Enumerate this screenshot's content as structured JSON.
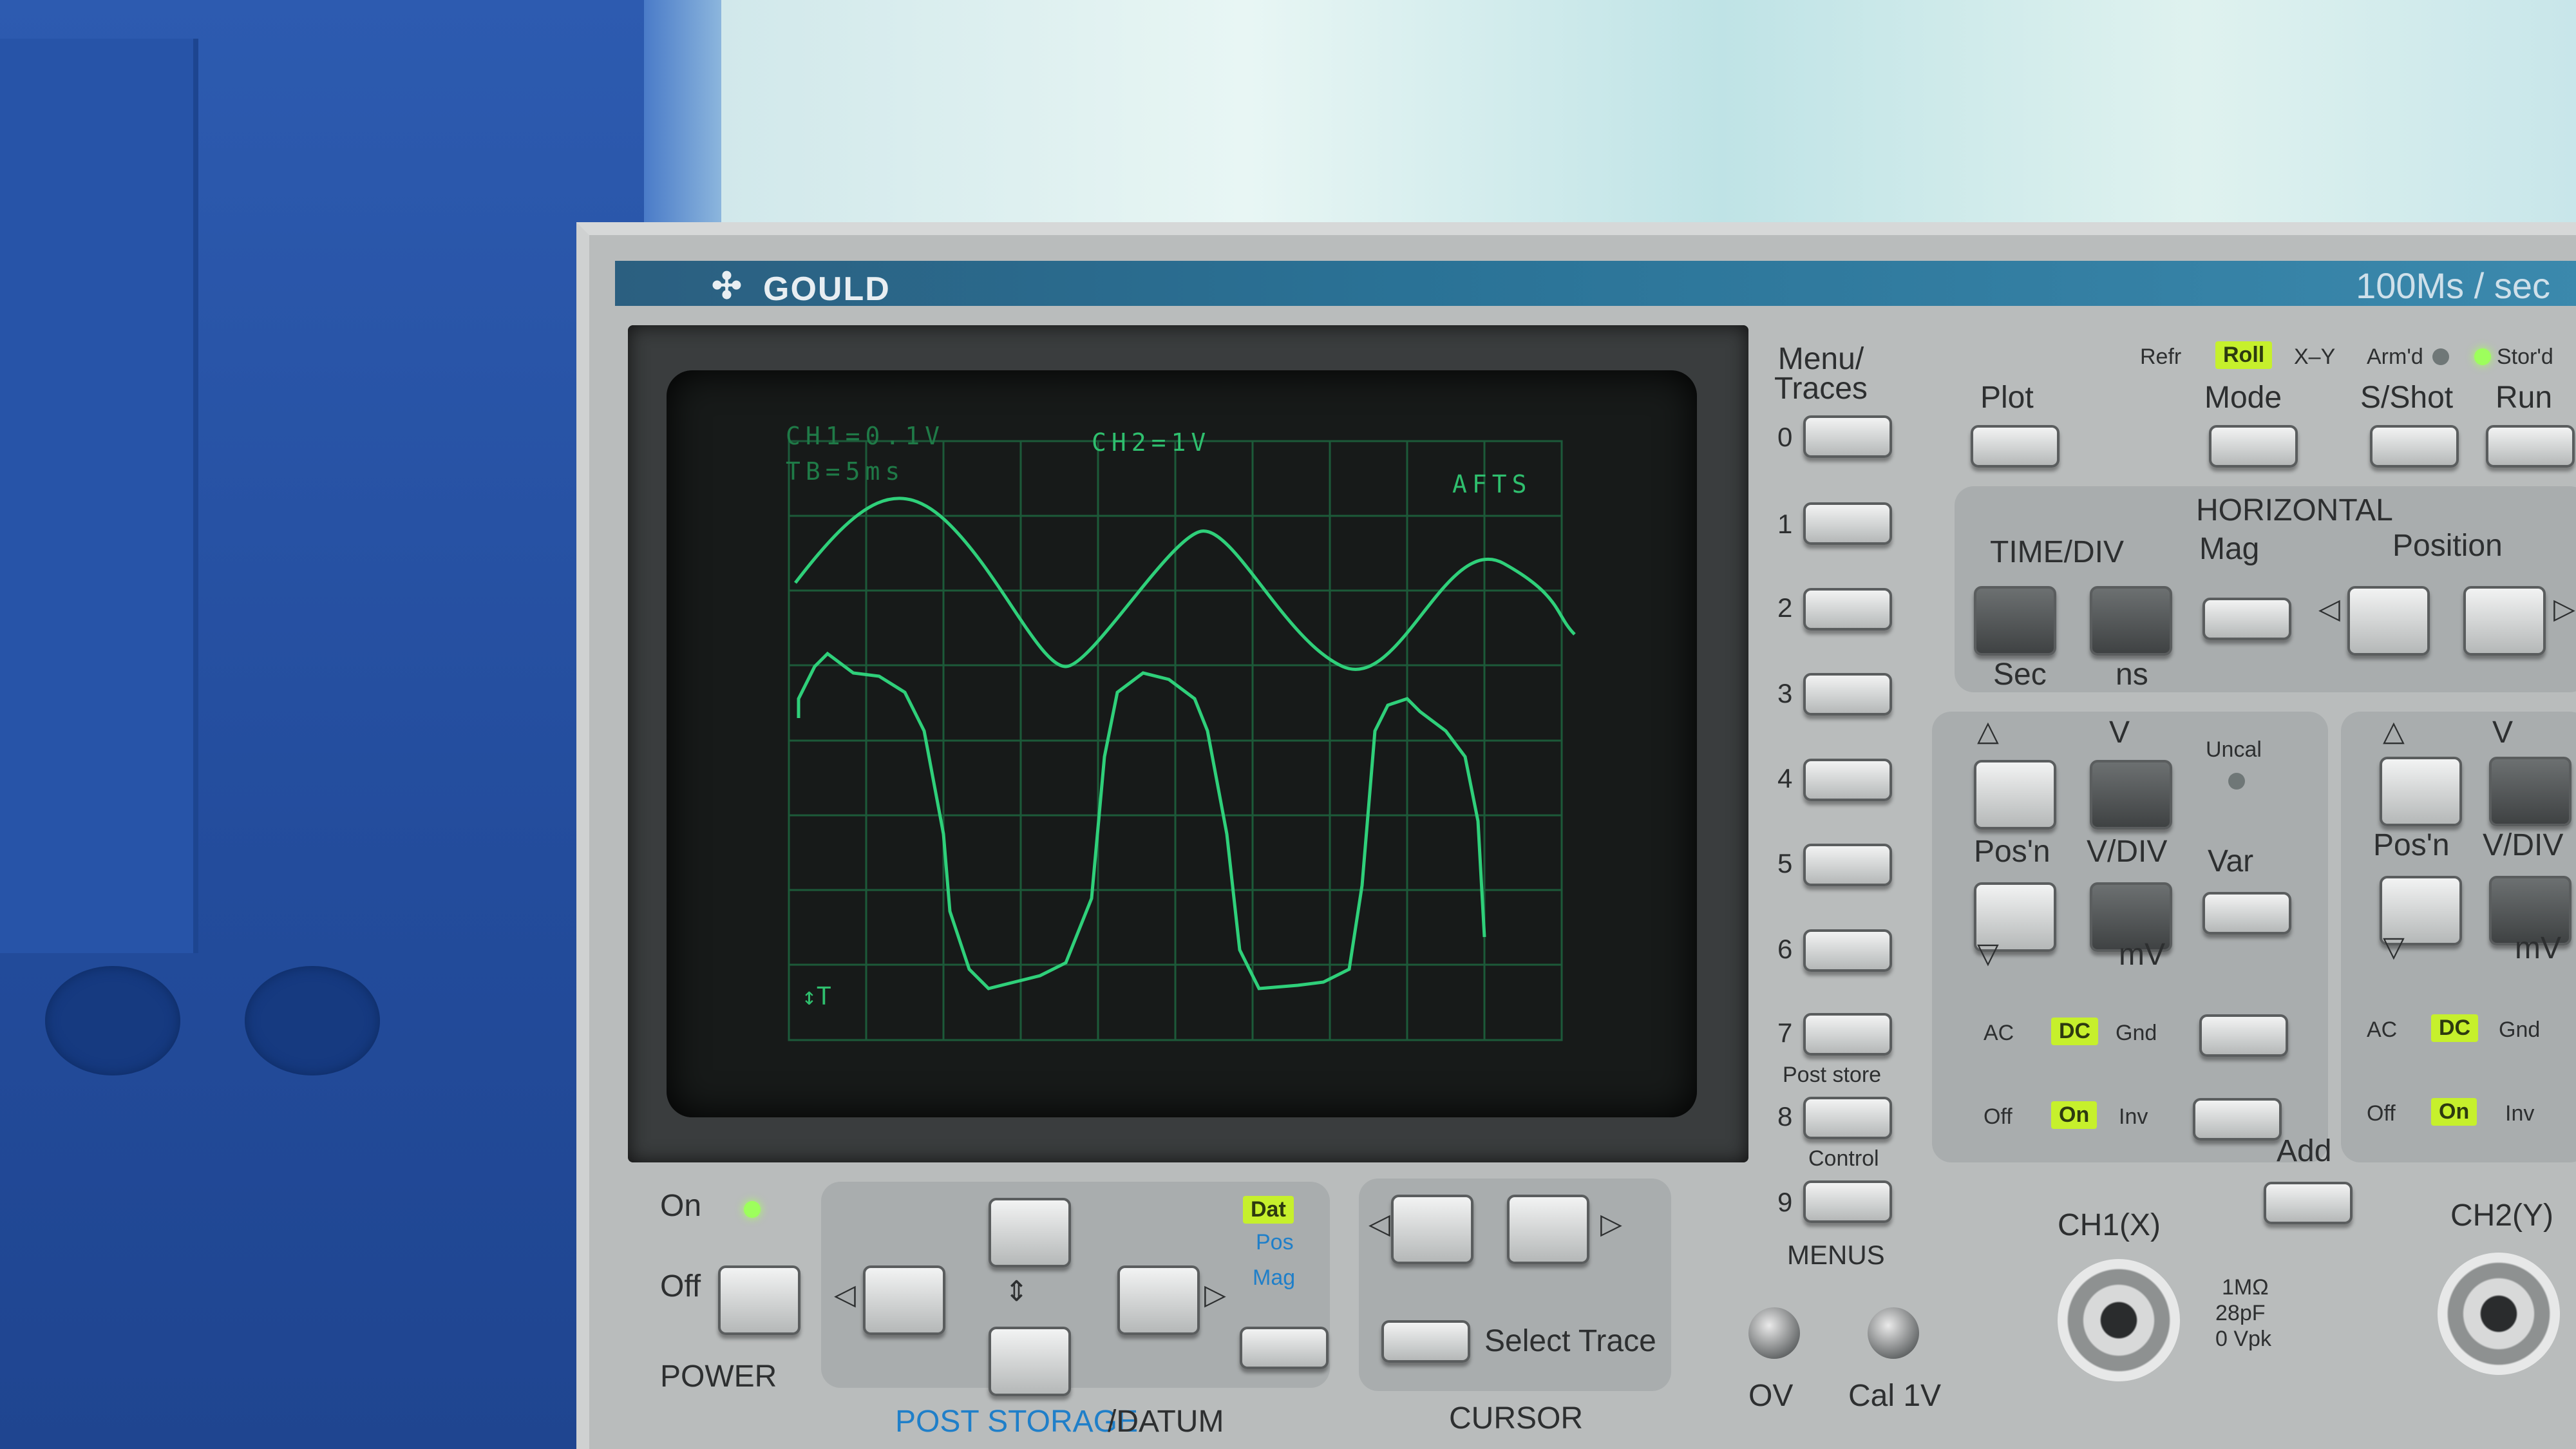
{
  "brand": {
    "logo_glyph": "✣",
    "name": "GOULD",
    "sample_rate": "100Ms / sec"
  },
  "screen": {
    "ch1_readout": "CH1=0.1V",
    "timebase_readout": "TB=5ms",
    "ch2_readout": "CH2=1V",
    "mode_readout": "AFTS",
    "trigger_marker": "↕T",
    "trace_color": "#2fd07a"
  },
  "menus": {
    "title": "Menu/\nTraces",
    "keys": [
      "0",
      "1",
      "2",
      "3",
      "4",
      "5",
      "6",
      "7",
      "8",
      "9"
    ],
    "post_store": "Post store",
    "control": "Control",
    "label": "MENUS"
  },
  "top_row": {
    "plot": "Plot",
    "mode": "Mode",
    "sshot": "S/Shot",
    "run": "Run",
    "indicators": {
      "refr": "Refr",
      "roll": "Roll",
      "xy": "X–Y",
      "armd": "Arm'd",
      "stord": "Stor'd"
    }
  },
  "horizontal": {
    "title": "HORIZONTAL",
    "time_div": "TIME/DIV",
    "mag": "Mag",
    "position": "Position",
    "sec": "Sec",
    "ns": "ns"
  },
  "ch1_vertical": {
    "posn": "Pos'n",
    "v": "V",
    "vdiv": "V/DIV",
    "mv": "mV",
    "uncal": "Uncal",
    "var": "Var",
    "ac": "AC",
    "dc": "DC",
    "gnd": "Gnd",
    "off": "Off",
    "on": "On",
    "inv": "Inv",
    "add": "Add",
    "connector": "CH1(X)",
    "spec": [
      "1MΩ",
      "28pF",
      "0 Vpk"
    ]
  },
  "ch2_vertical": {
    "posn": "Pos'n",
    "v": "V",
    "vdiv": "V/DIV",
    "mv": "mV",
    "ac": "AC",
    "dc": "DC",
    "gnd": "Gnd",
    "off": "Off",
    "on": "On",
    "inv": "Inv",
    "connector": "CH2(Y)"
  },
  "power": {
    "on": "On",
    "off": "Off",
    "label": "POWER"
  },
  "post_storage": {
    "label_a": "POST STORAGE",
    "label_b": "/DATUM",
    "dat": "Dat",
    "pos": "Pos",
    "mag": "Mag"
  },
  "cursor": {
    "select_trace": "Select Trace",
    "label": "CURSOR"
  },
  "bottom": {
    "ov": "OV",
    "cal": "Cal 1V"
  }
}
